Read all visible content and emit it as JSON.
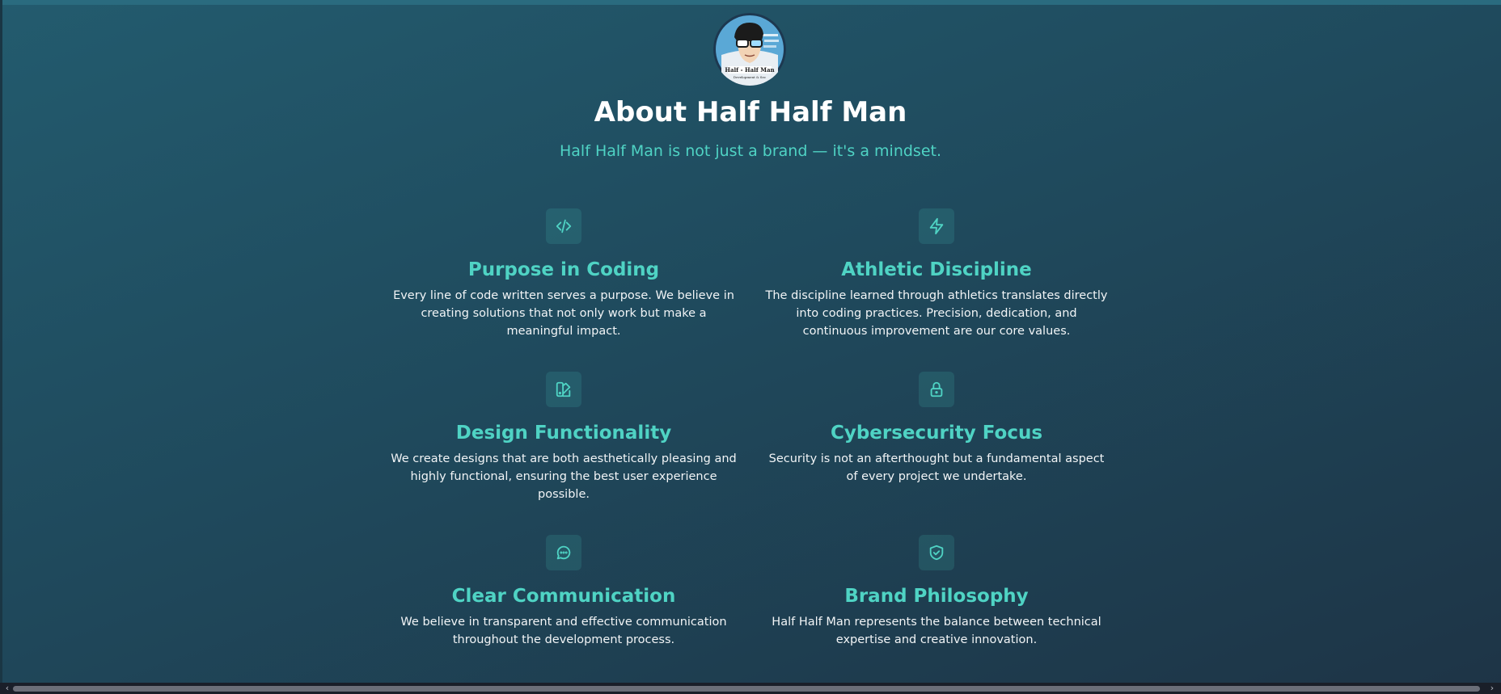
{
  "header": {
    "logo_icon": "half-half-man-logo",
    "title": "About Half Half Man",
    "subtitle": "Half Half Man is not just a brand — it's a mindset."
  },
  "features": [
    {
      "icon": "code-icon",
      "title": "Purpose in Coding",
      "description": "Every line of code written serves a purpose. We believe in creating solutions that not only work but make a meaningful impact."
    },
    {
      "icon": "lightning-icon",
      "title": "Athletic Discipline",
      "description": "The discipline learned through athletics translates directly into coding practices. Precision, dedication, and continuous improvement are our core values."
    },
    {
      "icon": "palette-icon",
      "title": "Design Functionality",
      "description": "We create designs that are both aesthetically pleasing and highly functional, ensuring the best user experience possible."
    },
    {
      "icon": "lock-icon",
      "title": "Cybersecurity Focus",
      "description": "Security is not an afterthought but a fundamental aspect of every project we undertake."
    },
    {
      "icon": "chat-icon",
      "title": "Clear Communication",
      "description": "We believe in transparent and effective communication throughout the development process."
    },
    {
      "icon": "shield-check-icon",
      "title": "Brand Philosophy",
      "description": "Half Half Man represents the balance between technical expertise and creative innovation."
    }
  ],
  "scrollbar": {
    "left_arrow": "‹",
    "right_arrow": "›"
  },
  "colors": {
    "accent": "#4fd3c4",
    "background_top": "#235b6e",
    "background_bottom": "#1e3446",
    "text": "#ffffff"
  }
}
